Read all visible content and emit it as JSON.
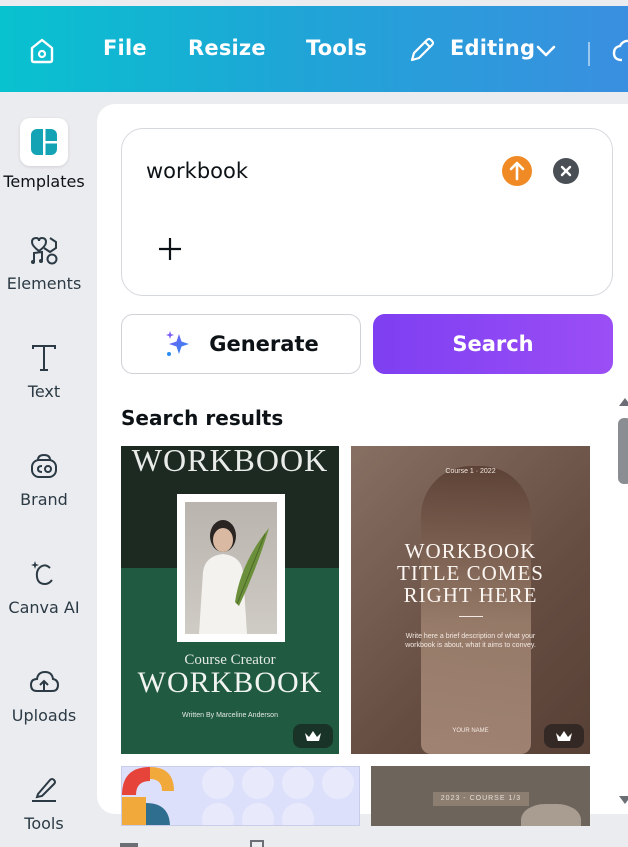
{
  "topbar": {
    "items": [
      {
        "label": "File"
      },
      {
        "label": "Resize"
      },
      {
        "label": "Tools"
      },
      {
        "label": "Editing"
      }
    ],
    "icons": [
      "home-icon",
      "pencil-icon",
      "chevron-down-icon",
      "cloud-icon"
    ],
    "gradient": [
      "#08c2cf",
      "#3a8fe0"
    ]
  },
  "sidebar": {
    "items": [
      {
        "label": "Templates",
        "icon": "templates-icon",
        "active": true
      },
      {
        "label": "Elements",
        "icon": "elements-icon"
      },
      {
        "label": "Text",
        "icon": "text-icon"
      },
      {
        "label": "Brand",
        "icon": "brand-icon"
      },
      {
        "label": "Canva AI",
        "icon": "canva-ai-icon"
      },
      {
        "label": "Uploads",
        "icon": "uploads-icon"
      },
      {
        "label": "Tools",
        "icon": "tools-icon"
      }
    ]
  },
  "panel": {
    "search": {
      "query": "workbook"
    },
    "generate_label": "Generate",
    "search_label": "Search",
    "results_title": "Search results",
    "accent": "#8b45f4"
  },
  "results": {
    "card1": {
      "heading": "WORKBOOK",
      "subtitle": "Course Creator",
      "title": "WORKBOOK",
      "author": "Written By Marceline Anderson"
    },
    "card2": {
      "kicker": "Course 1 · 2022",
      "title": "WORKBOOK TITLE COMES RIGHT HERE",
      "desc": "Write here a brief description of what your workbook is about, what it aims to convey.",
      "name": "YOUR NAME"
    },
    "card4": {
      "label": "2023 - COURSE 1/3"
    }
  }
}
